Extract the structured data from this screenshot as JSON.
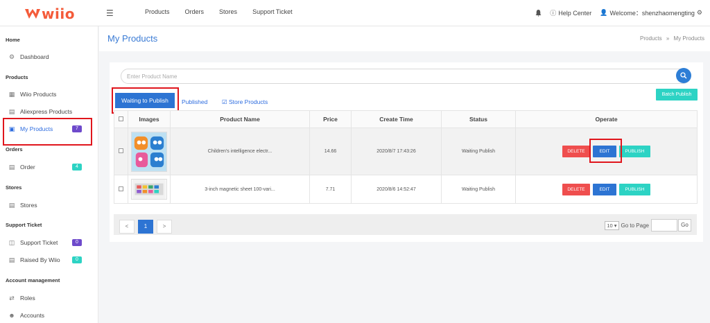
{
  "brand": {
    "logo_text": "wiio",
    "accent": "#f45b3a"
  },
  "topnav": [
    "Products",
    "Orders",
    "Stores",
    "Support Ticket"
  ],
  "topright": {
    "help": "Help Center",
    "welcome": "Welcome：shenzhaomengting"
  },
  "sidebar": {
    "sections": [
      {
        "title": "Home"
      },
      {
        "title": "Products"
      },
      {
        "title": "Orders"
      },
      {
        "title": "Stores"
      },
      {
        "title": "Support Ticket"
      },
      {
        "title": "Account management"
      }
    ],
    "items": [
      {
        "label": "Dashboard",
        "icon": "dashboard-icon"
      },
      {
        "label": "Wiio Products",
        "icon": "table-icon"
      },
      {
        "label": "Aliexpress Products",
        "icon": "list-icon"
      },
      {
        "label": "My Products",
        "icon": "briefcase-icon",
        "badge": "7",
        "active": true
      },
      {
        "label": "Order",
        "icon": "order-icon",
        "badge": "4"
      },
      {
        "label": "Stores",
        "icon": "store-icon"
      },
      {
        "label": "Support Ticket",
        "icon": "ticket-icon",
        "badge": "0"
      },
      {
        "label": "Raised By Wiio",
        "icon": "raised-icon",
        "badge": "0"
      },
      {
        "label": "Roles",
        "icon": "shuffle-icon"
      },
      {
        "label": "Accounts",
        "icon": "users-icon"
      }
    ]
  },
  "page": {
    "title": "My Products",
    "breadcrumb": [
      "Products",
      "My Products"
    ],
    "crumb_sep": "»"
  },
  "search": {
    "placeholder": "Enter Product Name"
  },
  "tabs": [
    "Waiting to Publish",
    "Published",
    "Store Products"
  ],
  "batch_publish": "Batch Publish",
  "table": {
    "headers": [
      "Images",
      "Product Name",
      "Price",
      "Create Time",
      "Status",
      "Operate"
    ],
    "rows": [
      {
        "name": "Children's intelligence electr...",
        "price": "14.66",
        "time": "2020/8/7 17:43:26",
        "status": "Waiting Publish"
      },
      {
        "name": "3-inch magnetic sheet 100-vari...",
        "price": "7.71",
        "time": "2020/8/6 14:52:47",
        "status": "Waiting Publish"
      }
    ],
    "actions": {
      "delete": "DELETE",
      "edit": "EDIT",
      "publish": "PUBLISH"
    }
  },
  "pager": {
    "prev": "<",
    "current": "1",
    "next": ">",
    "page_size": "10",
    "go_to_label": "Go to Page",
    "go": "Go"
  }
}
